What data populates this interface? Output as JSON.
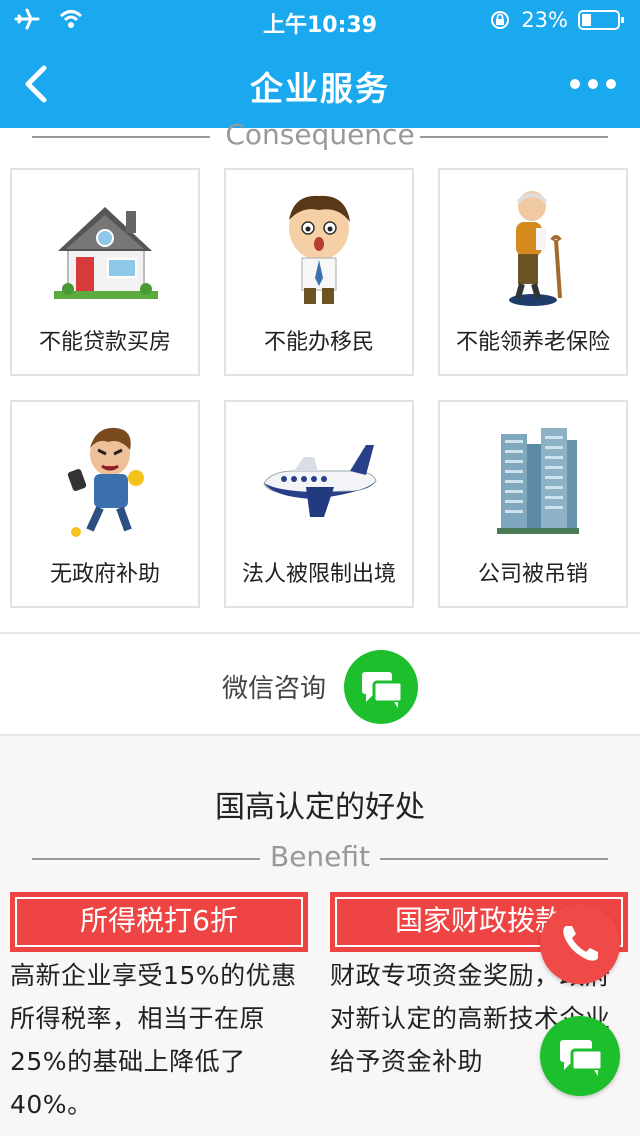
{
  "status_bar": {
    "time": "上午10:39",
    "battery": "23%"
  },
  "nav": {
    "title": "企业服务"
  },
  "consequence": {
    "heading": "Consequence",
    "items": [
      {
        "label": "不能贷款买房",
        "icon": "house-icon"
      },
      {
        "label": "不能办移民",
        "icon": "worried-boy-icon"
      },
      {
        "label": "不能领养老保险",
        "icon": "old-man-icon"
      },
      {
        "label": "无政府补助",
        "icon": "angry-man-icon"
      },
      {
        "label": "法人被限制出境",
        "icon": "airplane-icon"
      },
      {
        "label": "公司被吊销",
        "icon": "buildings-icon"
      }
    ]
  },
  "consult": {
    "label": "微信咨询"
  },
  "benefit": {
    "title": "国高认定的好处",
    "heading": "Benefit",
    "cards": [
      {
        "title": "所得税打6折",
        "text": "高新企业享受15%的优惠所得税率，相当于在原25%的基础上降低了40%。"
      },
      {
        "title": "国家财政拨款",
        "text": "财政专项资金奖励，政府对新认定的高新技术企业给予资金补助"
      }
    ]
  },
  "colors": {
    "brand_blue": "#1aa9ee",
    "accent_red": "#ee4544",
    "wechat_green": "#1dbf2d"
  }
}
